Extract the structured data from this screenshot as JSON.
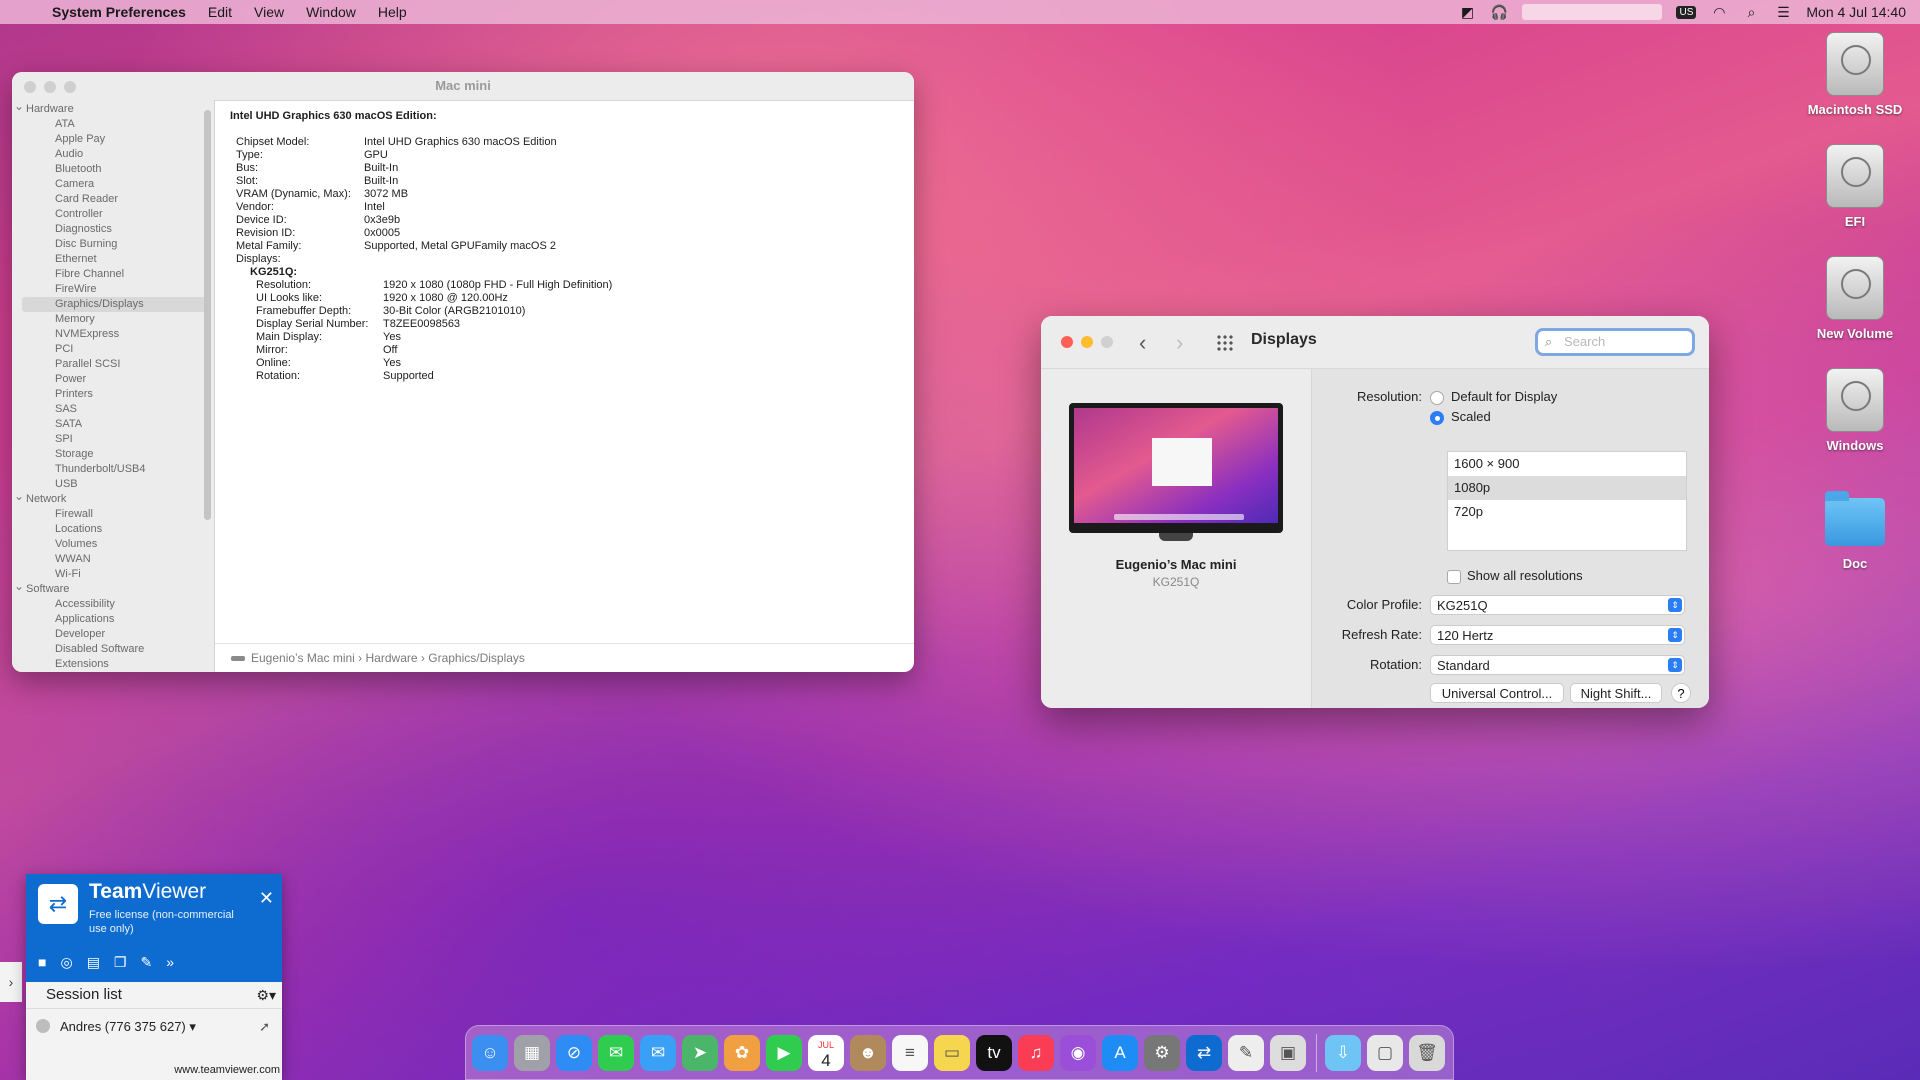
{
  "menubar": {
    "app_name": "System Preferences",
    "menus": [
      "Edit",
      "View",
      "Window",
      "Help"
    ],
    "input_source": "US",
    "clock": "Mon 4 Jul  14:40"
  },
  "desktop_icons": [
    {
      "label": "Macintosh SSD",
      "icon": "hard-drive-icon"
    },
    {
      "label": "EFI",
      "icon": "hard-drive-icon"
    },
    {
      "label": "New Volume",
      "icon": "hard-drive-icon"
    },
    {
      "label": "Windows",
      "icon": "hard-drive-icon"
    },
    {
      "label": "Doc",
      "icon": "folder-icon"
    }
  ],
  "sysinfo": {
    "title": "Mac mini",
    "tree": [
      {
        "type": "group",
        "label": "Hardware"
      },
      {
        "type": "leaf",
        "label": "ATA"
      },
      {
        "type": "leaf",
        "label": "Apple Pay"
      },
      {
        "type": "leaf",
        "label": "Audio"
      },
      {
        "type": "leaf",
        "label": "Bluetooth"
      },
      {
        "type": "leaf",
        "label": "Camera"
      },
      {
        "type": "leaf",
        "label": "Card Reader"
      },
      {
        "type": "leaf",
        "label": "Controller"
      },
      {
        "type": "leaf",
        "label": "Diagnostics"
      },
      {
        "type": "leaf",
        "label": "Disc Burning"
      },
      {
        "type": "leaf",
        "label": "Ethernet"
      },
      {
        "type": "leaf",
        "label": "Fibre Channel"
      },
      {
        "type": "leaf",
        "label": "FireWire"
      },
      {
        "type": "leaf",
        "label": "Graphics/Displays",
        "selected": true
      },
      {
        "type": "leaf",
        "label": "Memory"
      },
      {
        "type": "leaf",
        "label": "NVMExpress"
      },
      {
        "type": "leaf",
        "label": "PCI"
      },
      {
        "type": "leaf",
        "label": "Parallel SCSI"
      },
      {
        "type": "leaf",
        "label": "Power"
      },
      {
        "type": "leaf",
        "label": "Printers"
      },
      {
        "type": "leaf",
        "label": "SAS"
      },
      {
        "type": "leaf",
        "label": "SATA"
      },
      {
        "type": "leaf",
        "label": "SPI"
      },
      {
        "type": "leaf",
        "label": "Storage"
      },
      {
        "type": "leaf",
        "label": "Thunderbolt/USB4"
      },
      {
        "type": "leaf",
        "label": "USB"
      },
      {
        "type": "group",
        "label": "Network"
      },
      {
        "type": "leaf",
        "label": "Firewall"
      },
      {
        "type": "leaf",
        "label": "Locations"
      },
      {
        "type": "leaf",
        "label": "Volumes"
      },
      {
        "type": "leaf",
        "label": "WWAN"
      },
      {
        "type": "leaf",
        "label": "Wi-Fi"
      },
      {
        "type": "group",
        "label": "Software"
      },
      {
        "type": "leaf",
        "label": "Accessibility"
      },
      {
        "type": "leaf",
        "label": "Applications"
      },
      {
        "type": "leaf",
        "label": "Developer"
      },
      {
        "type": "leaf",
        "label": "Disabled Software"
      },
      {
        "type": "leaf",
        "label": "Extensions"
      }
    ],
    "detail_heading": "Intel UHD Graphics 630 macOS Edition:",
    "properties": [
      {
        "k": "Chipset Model:",
        "v": "Intel UHD Graphics 630 macOS Edition"
      },
      {
        "k": "Type:",
        "v": "GPU"
      },
      {
        "k": "Bus:",
        "v": "Built-In"
      },
      {
        "k": "Slot:",
        "v": "Built-In"
      },
      {
        "k": "VRAM (Dynamic, Max):",
        "v": "3072 MB"
      },
      {
        "k": "Vendor:",
        "v": "Intel"
      },
      {
        "k": "Device ID:",
        "v": "0x3e9b"
      },
      {
        "k": "Revision ID:",
        "v": "0x0005"
      },
      {
        "k": "Metal Family:",
        "v": "Supported, Metal GPUFamily macOS 2"
      },
      {
        "k": "Displays:",
        "v": ""
      }
    ],
    "display_name": "KG251Q:",
    "display_properties": [
      {
        "k": "Resolution:",
        "v": "1920 x 1080 (1080p FHD - Full High Definition)"
      },
      {
        "k": "UI Looks like:",
        "v": "1920 x 1080 @ 120.00Hz"
      },
      {
        "k": "Framebuffer Depth:",
        "v": "30-Bit Color (ARGB2101010)"
      },
      {
        "k": "Display Serial Number:",
        "v": "T8ZEE0098563"
      },
      {
        "k": "Main Display:",
        "v": "Yes"
      },
      {
        "k": "Mirror:",
        "v": "Off"
      },
      {
        "k": "Online:",
        "v": "Yes"
      },
      {
        "k": "Rotation:",
        "v": "Supported"
      }
    ],
    "path": [
      "Eugenio’s Mac mini",
      "Hardware",
      "Graphics/Displays"
    ]
  },
  "displays": {
    "title": "Displays",
    "search_placeholder": "Search",
    "device_name": "Eugenio’s Mac mini",
    "device_model": "KG251Q",
    "resolution_label": "Resolution:",
    "opt_default": "Default for Display",
    "opt_scaled": "Scaled",
    "resolutions": [
      "1600 × 900",
      "1080p",
      "720p"
    ],
    "selected_resolution": "1080p",
    "show_all": "Show all resolutions",
    "color_profile_label": "Color Profile:",
    "color_profile": "KG251Q",
    "refresh_label": "Refresh Rate:",
    "refresh": "120 Hertz",
    "rotation_label": "Rotation:",
    "rotation": "Standard",
    "universal_control": "Universal Control...",
    "night_shift": "Night Shift...",
    "help": "?"
  },
  "teamviewer": {
    "brand_bold": "Team",
    "brand_light": "Viewer",
    "license": "Free license (non-commercial use only)",
    "session_list": "Session list",
    "contact": "Andres (776 375 627)",
    "url": "www.teamviewer.com"
  },
  "dock": {
    "calendar_month": "JUL",
    "calendar_day": "4",
    "apps": [
      {
        "name": "finder-icon",
        "color": "#3b8ff0"
      },
      {
        "name": "launchpad-icon",
        "color": "#a0a0a8"
      },
      {
        "name": "safari-icon",
        "color": "#2d8df5"
      },
      {
        "name": "messages-icon",
        "color": "#2fcc4f"
      },
      {
        "name": "mail-icon",
        "color": "#3aa0f5"
      },
      {
        "name": "maps-icon",
        "color": "#4bb56a"
      },
      {
        "name": "photos-icon",
        "color": "#f0a040"
      },
      {
        "name": "facetime-icon",
        "color": "#2fcc4f"
      },
      {
        "name": "calendar-icon",
        "color": "#ffffff"
      },
      {
        "name": "contacts-icon",
        "color": "#b08a5c"
      },
      {
        "name": "reminders-icon",
        "color": "#f7f7f7"
      },
      {
        "name": "notes-icon",
        "color": "#f6d64e"
      },
      {
        "name": "apple-tv-icon",
        "color": "#111111"
      },
      {
        "name": "music-icon",
        "color": "#fa3c55"
      },
      {
        "name": "podcasts-icon",
        "color": "#9b4fd9"
      },
      {
        "name": "app-store-icon",
        "color": "#1e8cf5"
      },
      {
        "name": "system-preferences-icon",
        "color": "#777777"
      },
      {
        "name": "teamviewer-icon",
        "color": "#0e6cd0"
      },
      {
        "name": "textedit-icon",
        "color": "#eeeeee"
      },
      {
        "name": "preview-icon",
        "color": "#dddddd"
      },
      {
        "name": "downloads-folder-icon",
        "color": "#6ec5f5"
      },
      {
        "name": "screenshot-icon",
        "color": "#e8e8e8"
      },
      {
        "name": "trash-icon",
        "color": "#d9d9d9"
      }
    ]
  }
}
